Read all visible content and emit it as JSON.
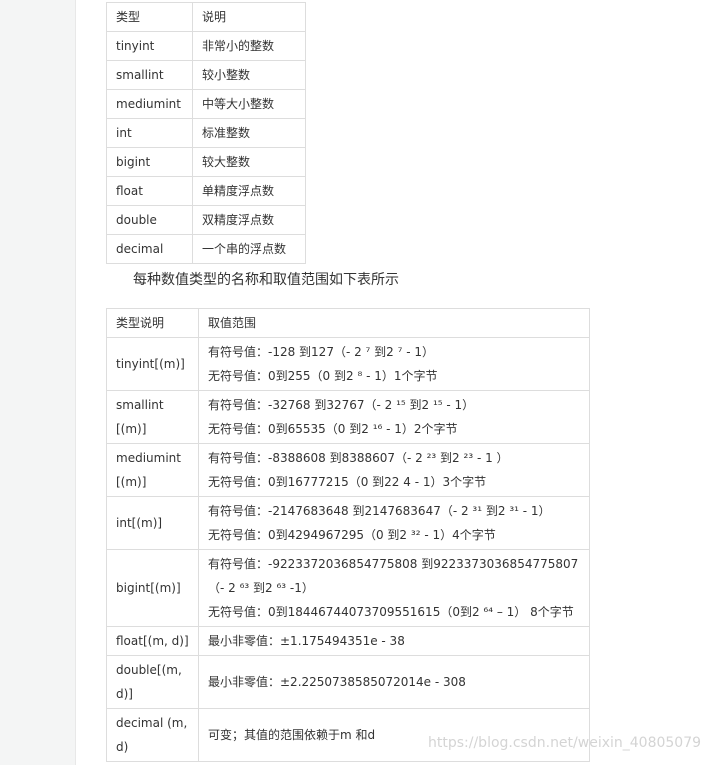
{
  "table1": {
    "header": [
      "类型",
      "说明"
    ],
    "rows": [
      [
        "tinyint",
        "非常小的整数"
      ],
      [
        "smallint",
        "较小整数"
      ],
      [
        "mediumint",
        "中等大小整数"
      ],
      [
        "int",
        "标准整数"
      ],
      [
        "bigint",
        "较大整数"
      ],
      [
        "float",
        "单精度浮点数"
      ],
      [
        "double",
        "双精度浮点数"
      ],
      [
        "decimal",
        "一个串的浮点数"
      ]
    ]
  },
  "caption": "每种数值类型的名称和取值范围如下表所示",
  "table2": {
    "header": [
      "类型说明",
      "取值范围"
    ],
    "rows": [
      {
        "type": "tinyint[(m)]",
        "lines": [
          "有符号值：-128 到127（- 2 ⁷ 到2 ⁷ - 1）",
          "无符号值：0到255（0 到2 ⁸ - 1）1个字节"
        ]
      },
      {
        "type": "smallint[(m)]",
        "lines": [
          "有符号值：-32768 到32767（- 2 ¹⁵ 到2 ¹⁵ - 1）",
          "无符号值：0到65535（0 到2 ¹⁶ - 1）2个字节"
        ]
      },
      {
        "type": "mediumint[(m)]",
        "lines": [
          "有符号值：-8388608 到8388607（- 2 ²³ 到2 ²³ - 1 ）",
          "无符号值：0到16777215（0 到22 4 - 1）3个字节"
        ]
      },
      {
        "type": "int[(m)]",
        "lines": [
          "有符号值：-2147683648 到2147683647（- 2 ³¹ 到2 ³¹ - 1）",
          "无符号值：0到4294967295（0 到2 ³² - 1）4个字节"
        ]
      },
      {
        "type": "bigint[(m)]",
        "lines": [
          "有符号值：-9223372036854775808 到9223373036854775807（- 2 ⁶³ 到2 ⁶³ -1）",
          "无符号值：0到18446744073709551615（0到2 ⁶⁴ – 1） 8个字节"
        ]
      },
      {
        "type": "float[(m, d)]",
        "lines": [
          "最小非零值：±1.175494351e - 38"
        ]
      },
      {
        "type": "double[(m,d)]",
        "lines": [
          "最小非零值：±2.2250738585072014e - 308"
        ]
      },
      {
        "type": "decimal (m, d)",
        "lines": [
          "可变；其值的范围依赖于m 和d"
        ]
      }
    ]
  },
  "watermark": "https://blog.csdn.net/weixin_40805079"
}
